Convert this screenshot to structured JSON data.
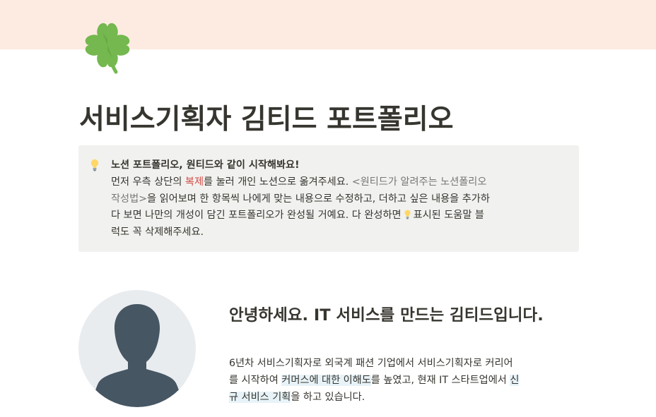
{
  "page": {
    "title": "서비스기획자 김티드 포트폴리오",
    "icon": "four-leaf-clover-icon",
    "cover_color": "#fdebe1"
  },
  "callout": {
    "icon": "light-bulb-icon",
    "background": "#f1f1ef",
    "title": "노션 포트폴리오, 원티드와 같이 시작해봐요!",
    "line1_a": "먼저 우측 상단의 ",
    "line1_link": "복제",
    "line1_b": "를 눌러 개인 노션으로 옮겨주세요. ",
    "line1_c": "<원티드가 알려주는 노션폴리오",
    "line2_a": "작성법>",
    "line2_b": "을 읽어보며 한 항목씩 나에게 맞는 내용으로 수정하고, 더하고 싶은 내용을 추가하",
    "line3_a": "다 보면 나만의 개성이 담긴 포트폴리오가 완성될 거예요. 다 완성하면",
    "line3_b": "표시된 도움말 블",
    "line4": "럭도 꼭 삭제해주세요."
  },
  "intro": {
    "avatar_icon": "person-silhouette-icon",
    "heading": "안녕하세요. IT 서비스를 만드는 김티드입니다.",
    "p_line1": "6년차 서비스기획자로 외국계 패션 기업에서 서비스기획자로 커리어",
    "p_line2_a": "를 시작하여 ",
    "p_line2_hl1": "커머스에 대한 이해도",
    "p_line2_b": "를 높였고, 현재 IT 스타트업에서 ",
    "p_line2_hl2": "신",
    "p_line3_hl": "규 서비스 기획",
    "p_line3_b": "을 하고 있습니다."
  },
  "colors": {
    "text": "#37352f",
    "red": "#d44c47",
    "gray": "#787774",
    "highlight": "#e7f3f8",
    "clover": "#74b84f",
    "avatar_bg": "#e9ecef",
    "avatar_figure": "#465663"
  }
}
